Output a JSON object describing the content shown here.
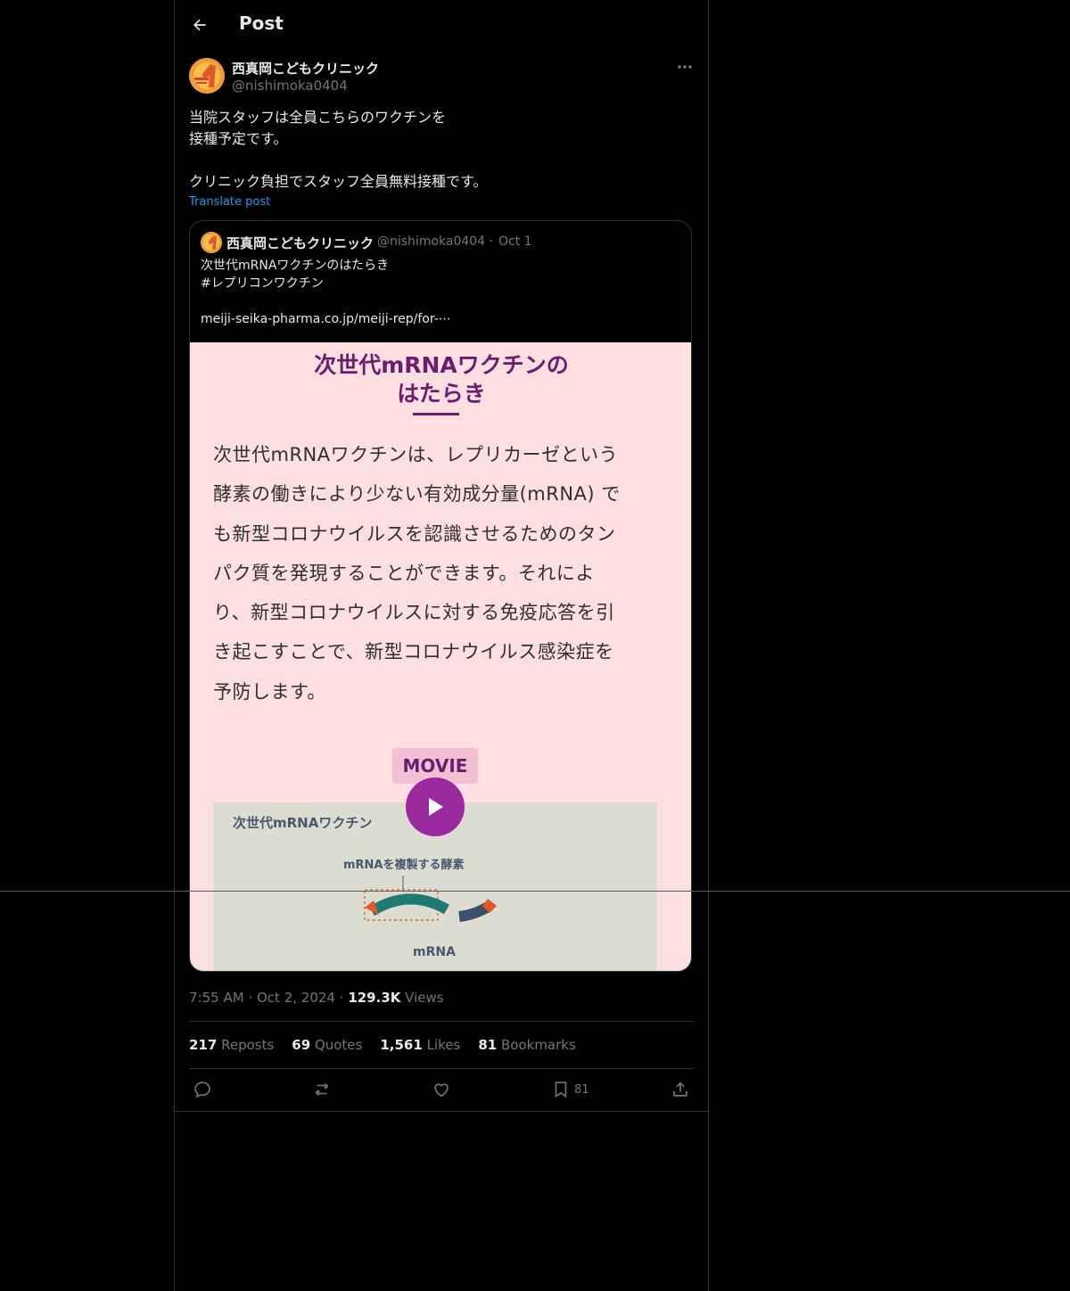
{
  "header": {
    "title": "Post"
  },
  "author": {
    "name": "西真岡こどもクリニック",
    "handle": "@nishimoka0404"
  },
  "post": {
    "lines": [
      "当院スタッフは全員こちらのワクチンを",
      "接種予定です。",
      "",
      "クリニック負担でスタッフ全員無料接種です。"
    ],
    "translate_label": "Translate post"
  },
  "quoted": {
    "name": "西真岡こどもクリニック",
    "handle": "@nishimoka0404",
    "dot": "·",
    "date": "Oct 1",
    "lines": [
      "次世代mRNAワクチンのはたらき",
      "#レプリコンワクチン",
      "",
      "meiji-seika-pharma.co.jp/meiji-rep/for-⋯"
    ],
    "media": {
      "title_line1": "次世代mRNAワクチンの",
      "title_line2": "はたらき",
      "body_lines": [
        "次世代mRNAワクチンは、レプリカーゼという",
        "酵素の働きにより少ない有効成分量(mRNA) で",
        "も新型コロナウイルスを認識させるためのタン",
        "パク質を発現することができます。それによ",
        "り、新型コロナウイルスに対する免疫応答を引",
        "き起こすことで、新型コロナウイルス感染症を",
        "予防します。"
      ],
      "movie_label": "MOVIE",
      "video_title": "次世代mRNAワクチン",
      "video_label": "mRNAを複製する酵素",
      "video_partial_label": "mRNA"
    }
  },
  "meta": {
    "time": "7:55 AM",
    "dot": "·",
    "date": "Oct 2, 2024",
    "views_count": "129.3K",
    "views_label": "Views"
  },
  "stats": {
    "reposts_count": "217",
    "reposts_label": "Reposts",
    "quotes_count": "69",
    "quotes_label": "Quotes",
    "likes_count": "1,561",
    "likes_label": "Likes",
    "bookmarks_count": "81",
    "bookmarks_label": "Bookmarks"
  },
  "actions": {
    "bookmark_count": "81"
  },
  "colors": {
    "accent": "#1d9bf0",
    "background": "#000000",
    "muted": "#71767b",
    "media_bg": "#fedfe1",
    "media_title": "#6b1e6f",
    "play": "#9b2aa0"
  },
  "icons": [
    "back-arrow-icon",
    "more-icon",
    "reply-icon",
    "repost-icon",
    "like-icon",
    "bookmark-icon",
    "share-icon",
    "play-icon"
  ]
}
